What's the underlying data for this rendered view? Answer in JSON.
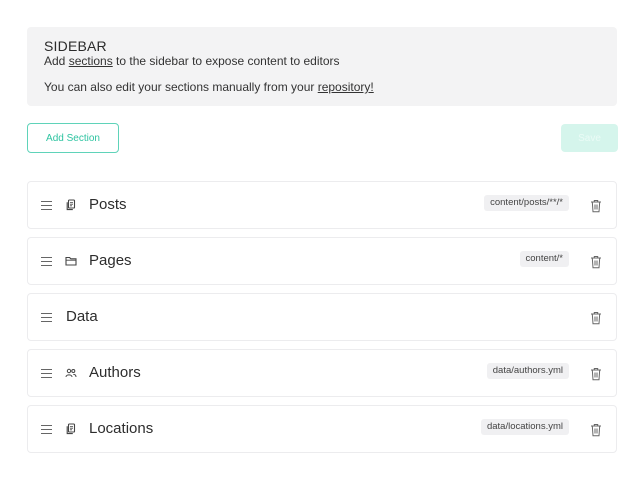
{
  "info": {
    "title": "SIDEBAR",
    "line1_prefix": "Add ",
    "line1_link": "sections",
    "line1_suffix": " to the sidebar to expose content to editors",
    "line2_prefix": "You can also edit your sections manually from your ",
    "line2_link": "repository!"
  },
  "actions": {
    "add_label": "Add Section",
    "save_label": "Save"
  },
  "sections": [
    {
      "label": "Posts",
      "icon": "documents-icon",
      "path": "content/posts/**/*"
    },
    {
      "label": "Pages",
      "icon": "folder-icon",
      "path": "content/*"
    },
    {
      "label": "Data",
      "icon": "",
      "path": ""
    },
    {
      "label": "Authors",
      "icon": "users-icon",
      "path": "data/authors.yml"
    },
    {
      "label": "Locations",
      "icon": "documents-icon",
      "path": "data/locations.yml"
    }
  ],
  "colors": {
    "accent": "#2ec4a1",
    "save_disabled_bg": "#d5f5ec",
    "info_bg": "#f3f3f4"
  }
}
